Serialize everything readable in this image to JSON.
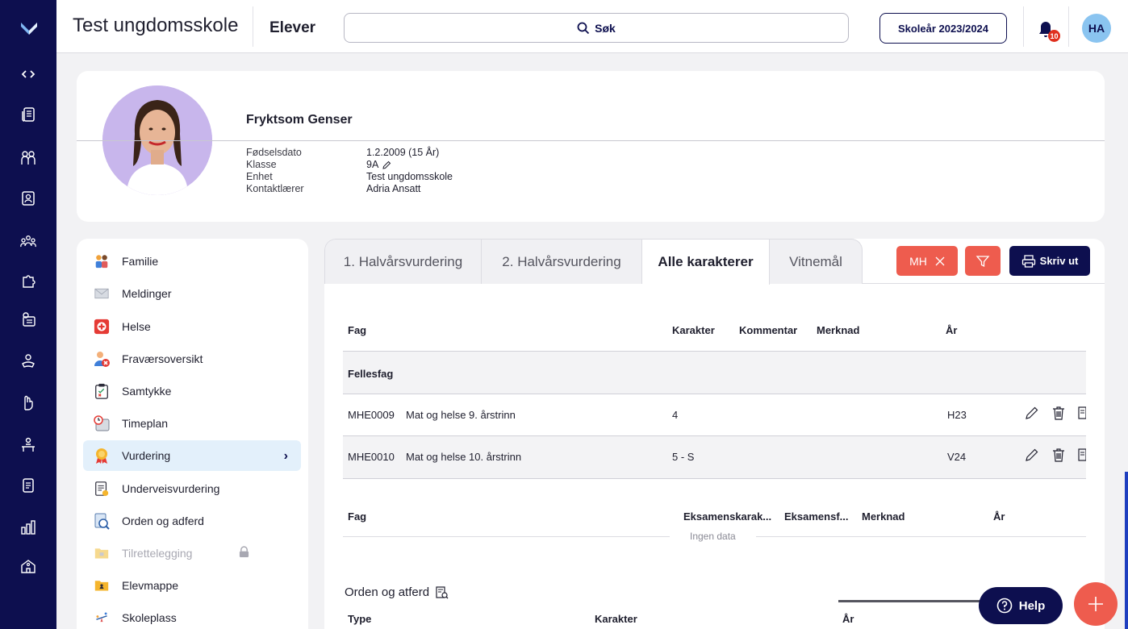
{
  "header": {
    "school": "Test ungdomsskole",
    "section": "Elever",
    "search_label": "Søk",
    "school_year": "Skoleår 2023/2024",
    "notification_count": "10",
    "user_initials": "HA"
  },
  "student": {
    "name": "Fryktsom Genser",
    "fields": [
      {
        "label": "Fødselsdato",
        "value": "1.2.2009 (15 År)"
      },
      {
        "label": "Klasse",
        "value": "9A"
      },
      {
        "label": "Enhet",
        "value": "Test ungdomsskole"
      },
      {
        "label": "Kontaktlærer",
        "value": "Adria Ansatt"
      }
    ]
  },
  "menu": {
    "items": [
      {
        "label": "Familie",
        "icon": "family-icon"
      },
      {
        "label": "Meldinger",
        "icon": "envelope-icon"
      },
      {
        "label": "Helse",
        "icon": "health-icon"
      },
      {
        "label": "Fraværsoversikt",
        "icon": "absence-icon"
      },
      {
        "label": "Samtykke",
        "icon": "consent-clipboard-icon"
      },
      {
        "label": "Timeplan",
        "icon": "schedule-icon"
      },
      {
        "label": "Vurdering",
        "icon": "award-icon",
        "active": true
      },
      {
        "label": "Underveisvurdering",
        "icon": "document-icon"
      },
      {
        "label": "Orden og adferd",
        "icon": "conduct-icon"
      },
      {
        "label": "Tilrettelegging",
        "icon": "folder-locked-icon",
        "disabled": true
      },
      {
        "label": "Elevmappe",
        "icon": "student-folder-icon"
      },
      {
        "label": "Skoleplass",
        "icon": "seesaw-icon"
      }
    ]
  },
  "tabs": {
    "t1": "1. Halvårsvurdering",
    "t2": "2. Halvårsvurdering",
    "t3": "Alle karakterer",
    "t4": "Vitnemål"
  },
  "toolbar": {
    "chip": "MH",
    "print": "Skriv ut"
  },
  "grades": {
    "headers": {
      "fag": "Fag",
      "karakter": "Karakter",
      "kommentar": "Kommentar",
      "merknad": "Merknad",
      "ar": "År"
    },
    "group": "Fellesfag",
    "rows": [
      {
        "code": "MHE0009",
        "subject": "Mat og helse 9. årstrinn",
        "grade": "4",
        "year": "H23"
      },
      {
        "code": "MHE0010",
        "subject": "Mat og helse 10. årstrinn",
        "grade": "5 - S",
        "year": "V24"
      }
    ]
  },
  "exam": {
    "headers": {
      "fag": "Fag",
      "eksamenskarakter": "Eksamenskarak...",
      "eksamensform": "Eksamensf...",
      "merknad": "Merknad",
      "ar": "År"
    },
    "empty": "Ingen data"
  },
  "conduct": {
    "title": "Orden og atferd",
    "headers": {
      "type": "Type",
      "karakter": "Karakter",
      "ar": "År"
    }
  },
  "help": "Help"
}
